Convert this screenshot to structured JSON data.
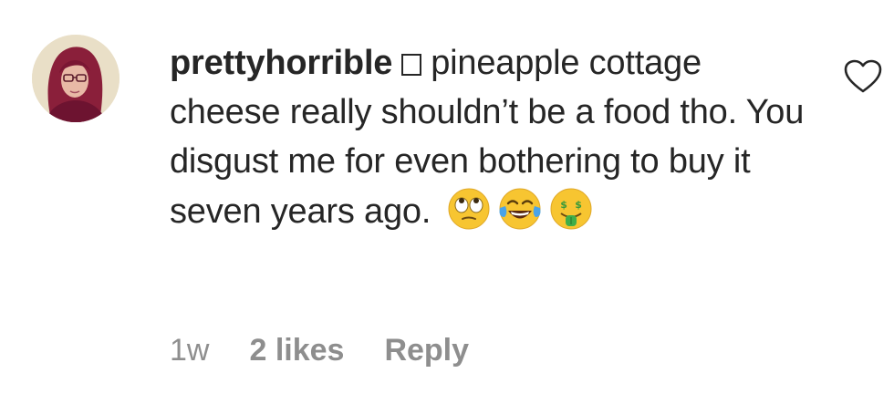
{
  "comment": {
    "username": "prettyhorrible",
    "username_symbol": "box-glyph",
    "text": "pineapple cottage cheese really shouldn’t be a food tho. You disgust me for even bothering to buy it seven years ago.",
    "emojis": [
      "face-with-rolling-eyes-emoji",
      "face-with-tears-of-joy-emoji",
      "money-mouth-face-emoji"
    ]
  },
  "meta": {
    "time": "1w",
    "likes": "2 likes",
    "reply": "Reply"
  },
  "icons": {
    "like": "heart-outline-icon"
  },
  "colors": {
    "text": "#262626",
    "secondary": "#8e8e8e",
    "emoji_yellow": "#f7c531"
  }
}
